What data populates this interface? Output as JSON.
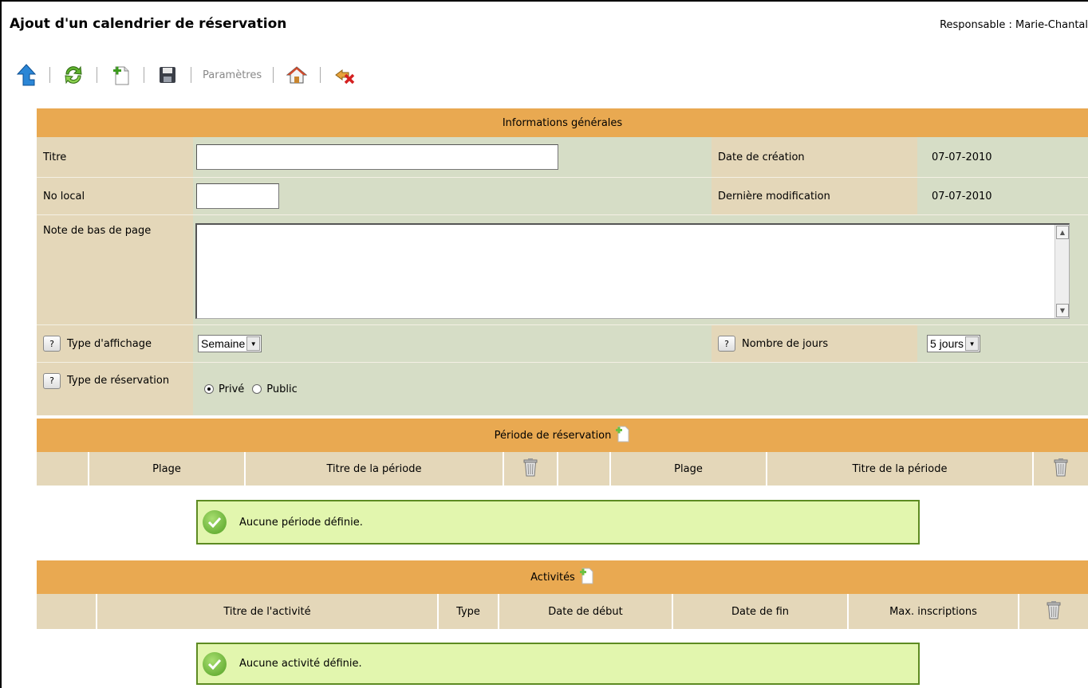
{
  "header": {
    "title": "Ajout d'un calendrier de réservation",
    "responsable": "Responsable : Marie-Chantal"
  },
  "toolbar": {
    "items": [
      "up-arrow-icon",
      "refresh-icon",
      "new-document-icon",
      "save-icon"
    ],
    "parametres_label": "Paramètres",
    "right_items": [
      "home-icon",
      "exit-icon"
    ]
  },
  "general": {
    "header": "Informations générales",
    "titre_label": "Titre",
    "titre_value": "",
    "date_creation_label": "Date de création",
    "date_creation_value": "07-07-2010",
    "no_local_label": "No local",
    "no_local_value": "",
    "derniere_modif_label": "Dernière modification",
    "derniere_modif_value": "07-07-2010",
    "note_label": "Note de bas de page",
    "note_value": "",
    "type_affichage_label": "Type d'affichage",
    "type_affichage_value": "Semaine",
    "nombre_jours_label": "Nombre de jours",
    "nombre_jours_value": "5 jours",
    "type_reservation_label": "Type de réservation",
    "reservation_options": {
      "prive": "Privé",
      "public": "Public",
      "selected": "Privé"
    },
    "help_glyph": "?"
  },
  "periode": {
    "header": "Période de réservation",
    "columns": [
      "Plage",
      "Titre de la période",
      "Plage",
      "Titre de la période"
    ],
    "empty_message": "Aucune période définie."
  },
  "activites": {
    "header": "Activités",
    "columns": [
      "Titre de l'activité",
      "Type",
      "Date de début",
      "Date de fin",
      "Max. inscriptions"
    ],
    "empty_message": "Aucune activité définie."
  },
  "colors": {
    "section_header": "#e9a951",
    "label_bg": "#e4d7b9",
    "value_bg": "#d6ddc6",
    "success_bg": "#e2f6ae",
    "success_border": "#5d8b22"
  }
}
